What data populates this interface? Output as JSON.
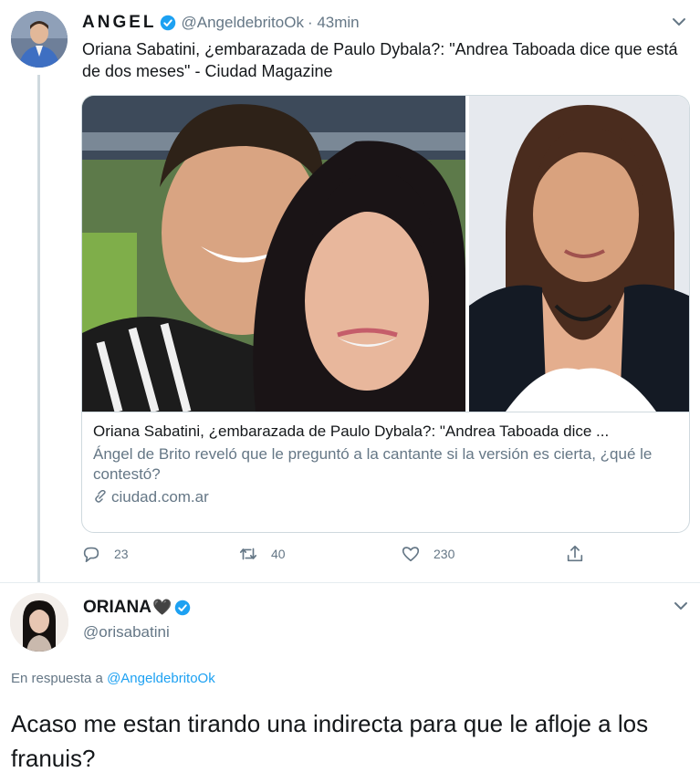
{
  "tweet": {
    "author": {
      "name": "ANGEL",
      "handle": "@AngeldebritoOk",
      "time": "· 43min"
    },
    "text": "Oriana Sabatini, ¿embarazada de Paulo Dybala?: \"Andrea Taboada dice que está de dos meses\" - Ciudad Magazine",
    "card": {
      "title": "Oriana Sabatini, ¿embarazada de Paulo Dybala?: \"Andrea Taboada dice ...",
      "description": "Ángel de Brito reveló que le preguntó a la cantante si la versión es cierta, ¿qué le contestó?",
      "domain": "ciudad.com.ar"
    },
    "actions": {
      "replies": "23",
      "retweets": "40",
      "likes": "230"
    }
  },
  "reply": {
    "author": {
      "name": "ORIANA",
      "name_emoji": "🖤",
      "handle": "@orisabatini"
    },
    "in_reply_prefix": "En respuesta a",
    "in_reply_handle": "@AngeldebritoOk",
    "text": "Acaso me estan tirando una indirecta para que le afloje a los franuis?"
  },
  "colors": {
    "verified": "#1da1f2",
    "link": "#1da1f2",
    "secondary_text": "#657786",
    "border": "#cfd9de"
  },
  "icons": {
    "reply": "speech-bubble-icon",
    "retweet": "retweet-icon",
    "like": "heart-icon",
    "share": "share-icon",
    "menu": "chevron-down-icon",
    "link": "link-icon",
    "verified": "verified-badge-icon"
  }
}
